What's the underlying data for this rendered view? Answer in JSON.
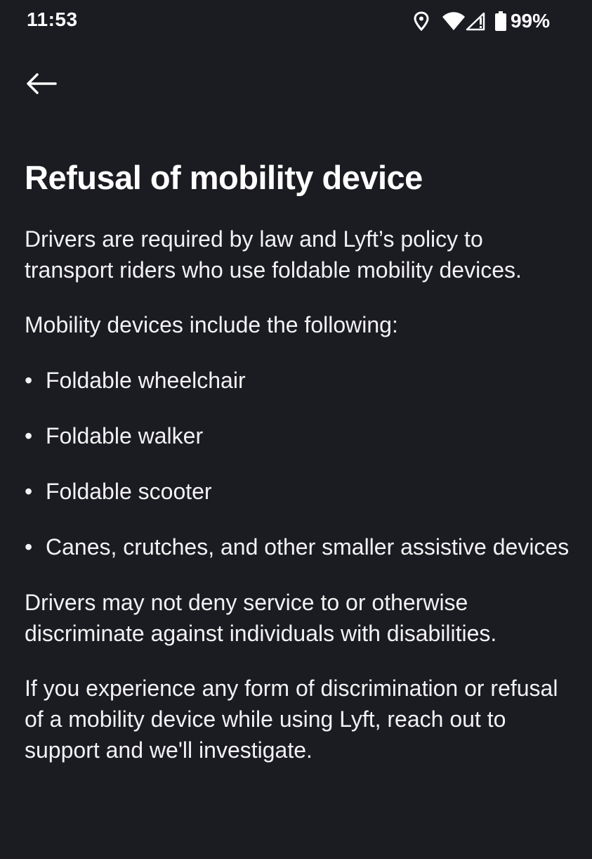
{
  "status_bar": {
    "time": "11:53",
    "battery_percent": "99%",
    "icons": [
      "location-icon",
      "wifi-icon",
      "signal-icon",
      "battery-icon"
    ]
  },
  "nav": {
    "back_icon": "arrow-left-icon"
  },
  "page": {
    "title": "Refusal of mobility device",
    "paragraph_1": "Drivers are required by law and Lyft’s policy to transport riders who use foldable mobility devices.",
    "paragraph_2": "Mobility devices include the following:",
    "list_items": [
      "Foldable wheelchair",
      "Foldable walker",
      "Foldable scooter",
      "Canes, crutches, and other smaller assistive devices"
    ],
    "bullet": "•",
    "paragraph_3": "Drivers may not deny service to or otherwise discriminate against individuals with disabilities.",
    "paragraph_4": "If you experience any form of discrimination or refusal of a mobility device while using Lyft, reach out to support and we'll investigate."
  },
  "colors": {
    "background": "#1b1b22",
    "text": "#ffffff"
  }
}
